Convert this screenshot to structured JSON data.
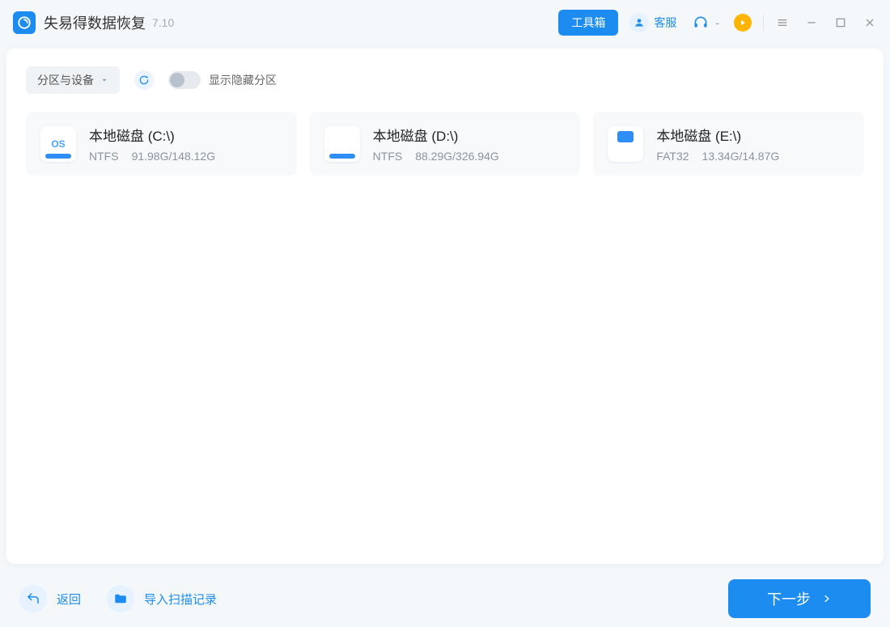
{
  "header": {
    "app_title": "失易得数据恢复",
    "version": "7.10",
    "toolbox_label": "工具箱",
    "support_label": "客服",
    "headset_label": "-"
  },
  "panel": {
    "dropdown_label": "分区与设备",
    "toggle_label": "显示隐藏分区"
  },
  "disks": [
    {
      "name": "本地磁盘 (C:\\)",
      "fs": "NTFS",
      "size": "91.98G/148.12G",
      "kind": "os"
    },
    {
      "name": "本地磁盘 (D:\\)",
      "fs": "NTFS",
      "size": "88.29G/326.94G",
      "kind": "plain"
    },
    {
      "name": "本地磁盘 (E:\\)",
      "fs": "FAT32",
      "size": "13.34G/14.87G",
      "kind": "fat"
    }
  ],
  "footer": {
    "back_label": "返回",
    "import_label": "导入扫描记录",
    "next_label": "下一步"
  }
}
